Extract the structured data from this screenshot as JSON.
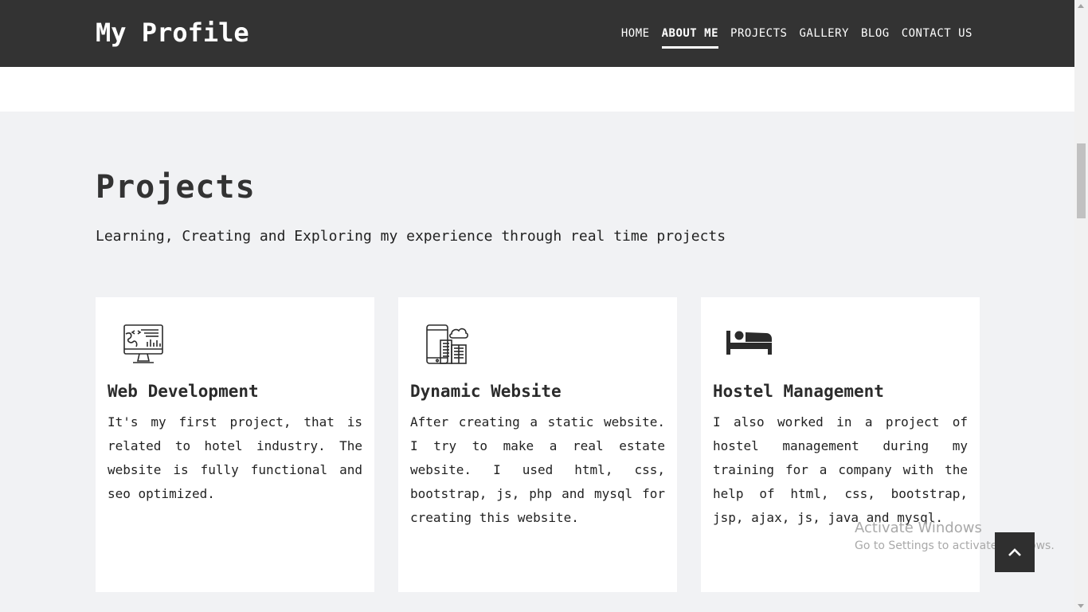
{
  "navbar": {
    "brand": "My Profile",
    "links": [
      {
        "label": "HOME",
        "active": false
      },
      {
        "label": "ABOUT ME",
        "active": true
      },
      {
        "label": "PROJECTS",
        "active": false
      },
      {
        "label": "GALLERY",
        "active": false
      },
      {
        "label": "BLOG",
        "active": false
      },
      {
        "label": "CONTACT US",
        "active": false
      }
    ]
  },
  "projects": {
    "title": "Projects",
    "subtitle": "Learning, Creating and Exploring my experience through real time projects",
    "cards": [
      {
        "icon": "web-development-monitor-icon",
        "title": "Web Development",
        "text": "It's my first project, that is related to hotel industry. The website is fully functional and seo optimized."
      },
      {
        "icon": "dynamic-website-device-icon",
        "title": "Dynamic Website",
        "text": "After creating a static website. I try to make a real estate website. I used html, css, bootstrap, js, php and mysql for creating this website."
      },
      {
        "icon": "bed-icon",
        "title": "Hostel Management",
        "text": "I also worked in a project of hostel management during my training for a company with the help of html, css, bootstrap, jsp, ajax, js, java and mysql."
      }
    ]
  },
  "watermark": {
    "title": "Activate Windows",
    "subtitle": "Go to Settings to activate Windows."
  },
  "back_to_top": {
    "icon": "chevron-up-icon"
  },
  "colors": {
    "navbar_bg": "#333333",
    "section_bg": "#f1f2f4",
    "card_bg": "#ffffff",
    "to_top_bg": "#2f2f2f"
  }
}
